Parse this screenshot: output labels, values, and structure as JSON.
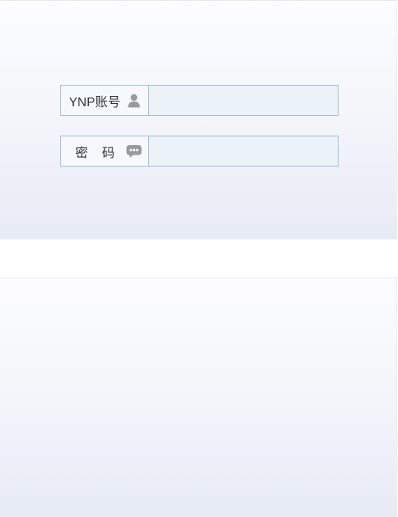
{
  "login": {
    "account": {
      "label": "YNP账号",
      "icon": "user-icon",
      "value": "",
      "placeholder": ""
    },
    "password": {
      "label": "密    码",
      "icon": "chat-bubble-icon",
      "value": "",
      "placeholder": ""
    }
  },
  "colors": {
    "border": "#9dbfd0",
    "input_bg": "#ebf3f8",
    "label_text": "#333333",
    "icon_gray": "#9a9a9a"
  }
}
